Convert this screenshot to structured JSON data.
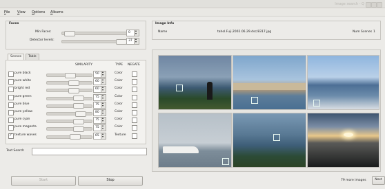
{
  "window": {
    "title": "Image search - Q"
  },
  "menu": {
    "items": [
      "File",
      "View",
      "Options",
      "Albums"
    ]
  },
  "faces": {
    "title": "Faces",
    "min_faces_label": "Min Faces:",
    "min_faces_value": "0",
    "detector_levels_label": "Detector levels:",
    "detector_levels_value": "37",
    "min_faces_slider": 0.05,
    "detector_levels_slider": 0.95
  },
  "tabs": {
    "scenes": "Scenes",
    "table": "Table"
  },
  "scenes_table": {
    "headers": {
      "similarity": "SIMILARITY",
      "type": "TYPE",
      "negate": "NEGATE"
    },
    "rows": [
      {
        "name": "pure black",
        "value": "50",
        "level": 0.5,
        "type": "Color",
        "checked": false,
        "negate": false
      },
      {
        "name": "pure white",
        "value": "60",
        "level": 0.6,
        "type": "Color",
        "checked": false,
        "negate": false
      },
      {
        "name": "bright red",
        "value": "60",
        "level": 0.6,
        "type": "Color",
        "checked": false,
        "negate": false
      },
      {
        "name": "pure green",
        "value": "75",
        "level": 0.75,
        "type": "Color",
        "checked": false,
        "negate": false
      },
      {
        "name": "pure blue",
        "value": "75",
        "level": 0.75,
        "type": "Color",
        "checked": false,
        "negate": false
      },
      {
        "name": "pure yellow",
        "value": "80",
        "level": 0.8,
        "type": "Color",
        "checked": false,
        "negate": false
      },
      {
        "name": "pure cyan",
        "value": "75",
        "level": 0.75,
        "type": "Color",
        "checked": false,
        "negate": false
      },
      {
        "name": "pure magenta",
        "value": "75",
        "level": 0.75,
        "type": "Color",
        "checked": false,
        "negate": false
      },
      {
        "name": "texture waves",
        "value": "65",
        "level": 0.65,
        "type": "Texture",
        "checked": true,
        "negate": false
      }
    ]
  },
  "text_search": {
    "label": "Text Search",
    "value": ""
  },
  "buttons": {
    "start": "Start",
    "stop": "Stop",
    "next": "Next"
  },
  "image_info": {
    "title": "Image Info",
    "name_label": "Name",
    "name_value": "tahol.Fuji.2002.06.29.dsc/8317.jpg",
    "num_scenes_label": "Num Scenes",
    "num_scenes_value": "1"
  },
  "results": {
    "count_text": "79 more images"
  },
  "colors": {
    "background": "#ecebe8",
    "panel_border": "#c8c6c1",
    "selection_box": "#e6f6f0"
  }
}
